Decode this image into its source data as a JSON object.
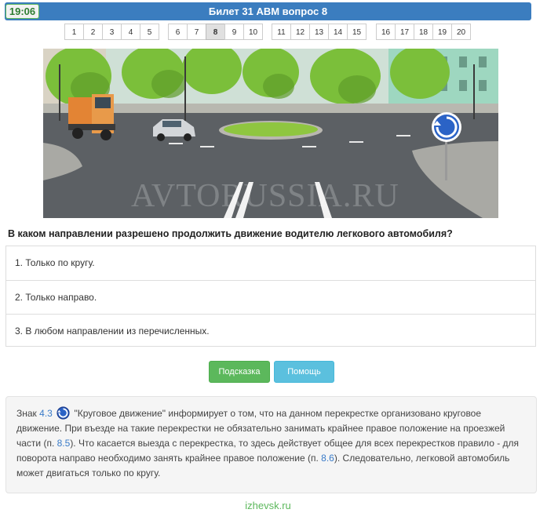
{
  "header": {
    "timer": "19:06",
    "title": "Билет 31 ABM вопрос 8"
  },
  "pager": {
    "groups": [
      [
        "1",
        "2",
        "3",
        "4",
        "5"
      ],
      [
        "6",
        "7",
        "8",
        "9",
        "10"
      ],
      [
        "11",
        "12",
        "13",
        "14",
        "15"
      ],
      [
        "16",
        "17",
        "18",
        "19",
        "20"
      ]
    ],
    "active": "8"
  },
  "image": {
    "watermark": "AVTORUSSIA.RU"
  },
  "question": "В каком направлении разрешено продолжить движение водителю легкового автомобиля?",
  "answers": [
    "1. Только по кругу.",
    "2. Только направо.",
    "3. В любом направлении из перечисленных."
  ],
  "buttons": {
    "hint": "Подсказка",
    "help": "Помощь"
  },
  "explanation": {
    "p1": "Знак ",
    "sign_ref": "4.3",
    "p2": " \"Круговое движение\" информирует о том, что на данном перекрестке организовано круговое движение. При въезде на такие перекрестки не обязательно занимать крайнее правое положение на проезжей части (п. ",
    "ref1": "8.5",
    "p3": "). Что касается выезда с перекрестка, то здесь действует общее для всех перекрестков правило - для поворота направо необходимо занять крайнее правое положение (п. ",
    "ref2": "8.6",
    "p4": "). Следовательно, легковой автомобиль может двигаться только по кругу."
  },
  "footer": "izhevsk.ru",
  "colors": {
    "header_bg": "#3b7dbf",
    "hint_btn": "#5cb85c",
    "help_btn": "#5bc0de",
    "link": "#3a7bc8"
  }
}
